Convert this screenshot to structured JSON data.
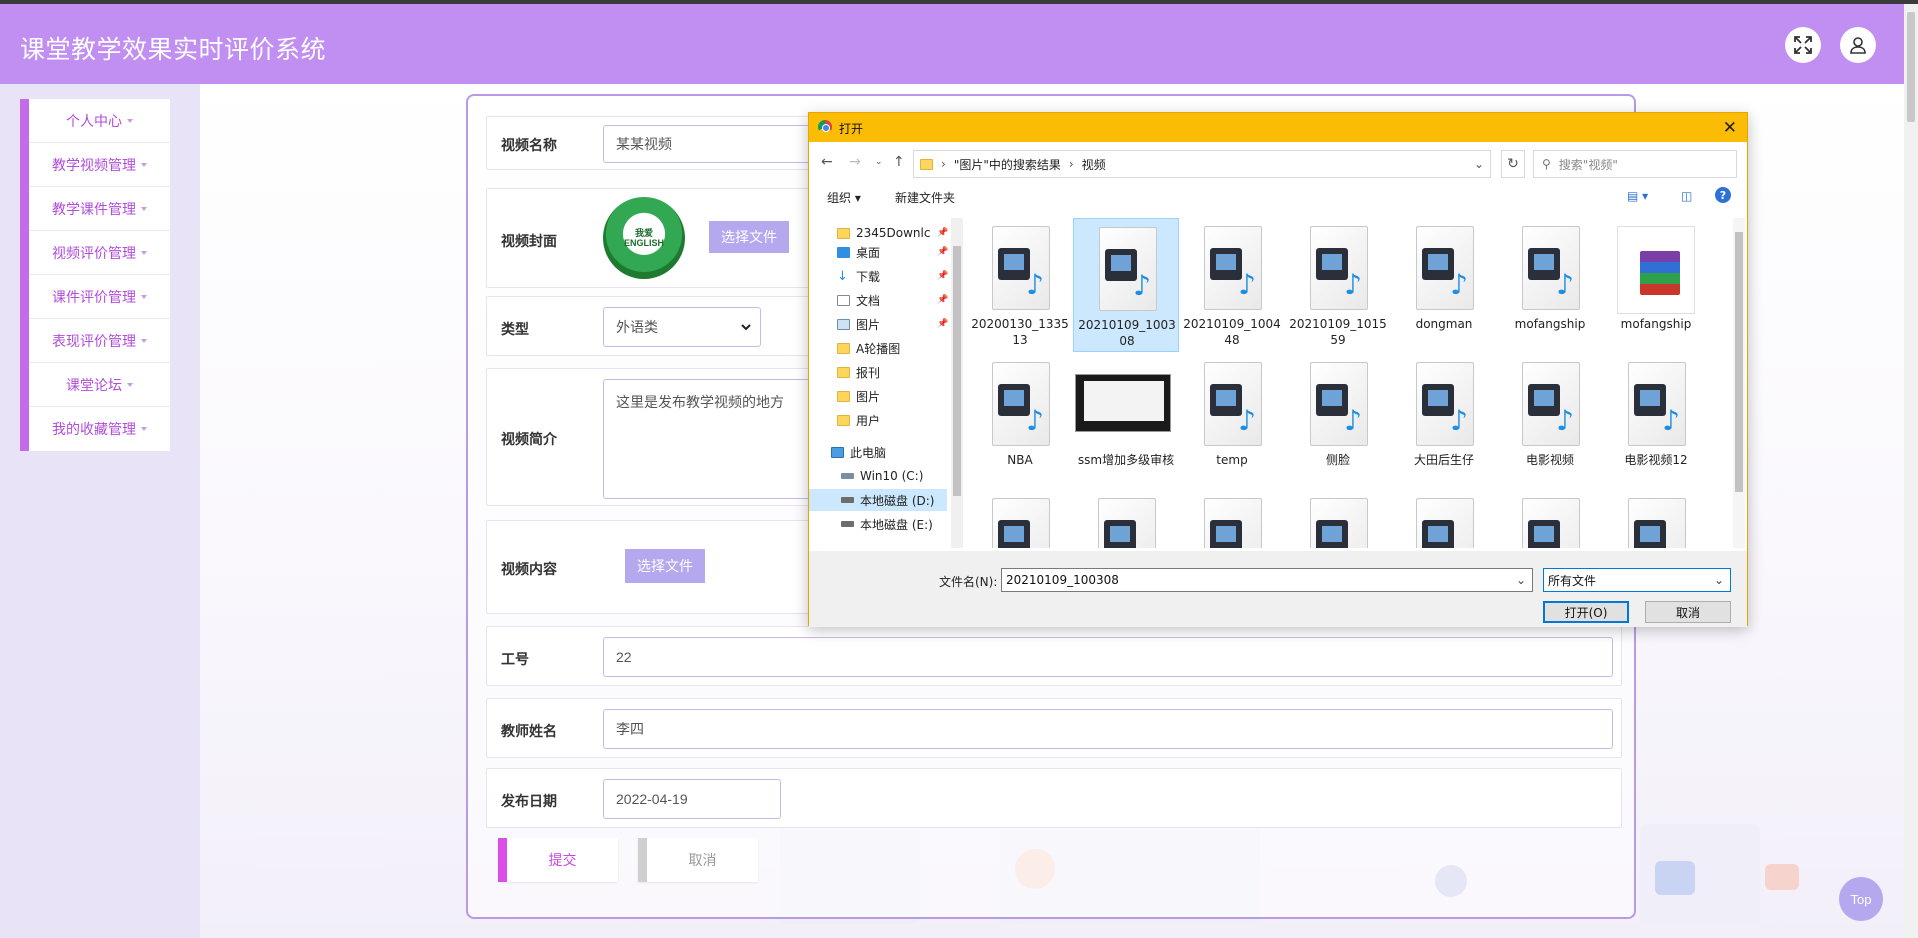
{
  "app": {
    "title": "课堂教学效果实时评价系统"
  },
  "header": {
    "fullscreen_icon": "expand-icon",
    "user_icon": "user-icon"
  },
  "sidebar": {
    "items": [
      {
        "label": "个人中心"
      },
      {
        "label": "教学视频管理"
      },
      {
        "label": "教学课件管理"
      },
      {
        "label": "视频评价管理"
      },
      {
        "label": "课件评价管理"
      },
      {
        "label": "表现评价管理"
      },
      {
        "label": "课堂论坛"
      },
      {
        "label": "我的收藏管理"
      }
    ]
  },
  "form": {
    "video_name": {
      "label": "视频名称",
      "value": "某某视频"
    },
    "cover": {
      "label": "视频封面",
      "button": "选择文件",
      "logo_line1": "我爱",
      "logo_line2": "ENGLISH"
    },
    "type": {
      "label": "类型",
      "value": "外语类"
    },
    "intro": {
      "label": "视频简介",
      "value": "这里是发布教学视频的地方"
    },
    "content": {
      "label": "视频内容",
      "button": "选择文件"
    },
    "job_no": {
      "label": "工号",
      "value": "22"
    },
    "teacher": {
      "label": "教师姓名",
      "value": "李四"
    },
    "date": {
      "label": "发布日期",
      "value": "2022-04-19"
    },
    "submit": "提交",
    "cancel": "取消"
  },
  "top_button": "Top",
  "dialog": {
    "title": "打开",
    "path": [
      "\"图片\"中的搜索结果",
      "视频"
    ],
    "search_placeholder": "搜索\"视频\"",
    "toolbar": {
      "organize": "组织",
      "new_folder": "新建文件夹"
    },
    "nav": [
      {
        "label": "2345Downlc",
        "icon": "folder",
        "pinned": true
      },
      {
        "label": "桌面",
        "icon": "desktop",
        "pinned": true
      },
      {
        "label": "下载",
        "icon": "download",
        "pinned": true
      },
      {
        "label": "文档",
        "icon": "document",
        "pinned": true
      },
      {
        "label": "图片",
        "icon": "pictures",
        "pinned": true
      },
      {
        "label": "A轮播图",
        "icon": "folder"
      },
      {
        "label": "报刊",
        "icon": "folder"
      },
      {
        "label": "图片",
        "icon": "folder"
      },
      {
        "label": "用户",
        "icon": "folder"
      },
      {
        "label": "此电脑",
        "icon": "computer"
      },
      {
        "label": "Win10 (C:)",
        "icon": "drive"
      },
      {
        "label": "本地磁盘 (D:)",
        "icon": "drive"
      },
      {
        "label": "本地磁盘 (E:)",
        "icon": "drive"
      }
    ],
    "files": [
      {
        "name": "20200130_133513",
        "kind": "video"
      },
      {
        "name": "20210109_100308",
        "kind": "video"
      },
      {
        "name": "20210109_100448",
        "kind": "video"
      },
      {
        "name": "20210109_101559",
        "kind": "video"
      },
      {
        "name": "dongman",
        "kind": "video"
      },
      {
        "name": "mofangship",
        "kind": "video"
      },
      {
        "name": "mofangship",
        "kind": "archive"
      },
      {
        "name": "NBA",
        "kind": "video"
      },
      {
        "name": "ssm增加多级审核",
        "kind": "video-thumb"
      },
      {
        "name": "temp",
        "kind": "video"
      },
      {
        "name": "侧脸",
        "kind": "video"
      },
      {
        "name": "大田后生仔",
        "kind": "video"
      },
      {
        "name": "电影视频",
        "kind": "video"
      },
      {
        "name": "电影视频12",
        "kind": "video"
      }
    ],
    "filename_label": "文件名(N):",
    "filename_value": "20210109_100308",
    "filter_value": "所有文件",
    "open_button": "打开(O)",
    "cancel_button": "取消"
  }
}
